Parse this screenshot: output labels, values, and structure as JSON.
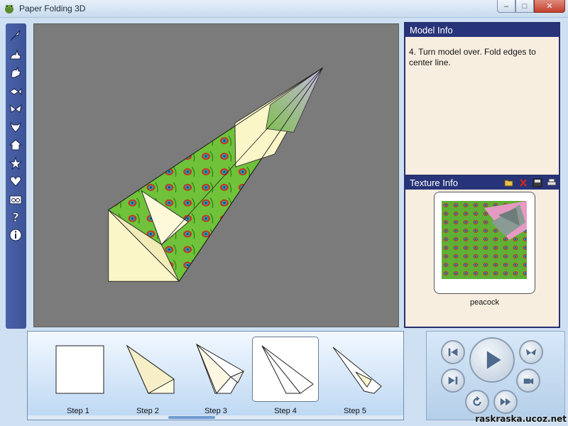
{
  "window": {
    "title": "Paper Folding 3D",
    "minimize": "–",
    "maximize": "□",
    "close": "✕"
  },
  "toolbar": {
    "items": [
      {
        "icon": "bird-icon"
      },
      {
        "icon": "rabbit-icon"
      },
      {
        "icon": "rooster-icon"
      },
      {
        "icon": "fish-icon"
      },
      {
        "icon": "butterfly-icon"
      },
      {
        "icon": "bull-head-icon"
      },
      {
        "icon": "house-icon"
      },
      {
        "icon": "star-icon"
      },
      {
        "icon": "heart-icon"
      },
      {
        "icon": "glasses-icon"
      },
      {
        "icon": "help-icon"
      },
      {
        "icon": "info-icon"
      }
    ]
  },
  "model_info": {
    "header": "Model Info",
    "text": "4. Turn model over. Fold edges to center line."
  },
  "texture_info": {
    "header": "Texture Info",
    "texture_name": "peacock",
    "header_icons": [
      "open-folder-icon",
      "delete-icon",
      "save-icon",
      "print-icon"
    ]
  },
  "steps": [
    {
      "label": "Step 1",
      "selected": false
    },
    {
      "label": "Step 2",
      "selected": false
    },
    {
      "label": "Step 3",
      "selected": false
    },
    {
      "label": "Step 4",
      "selected": true
    },
    {
      "label": "Step 5",
      "selected": false
    }
  ],
  "player": {
    "buttons": [
      "skip-to-start-icon",
      "play-icon",
      "butterfly-mode-icon",
      "skip-to-end-icon",
      "camera-icon",
      "rotate-icon",
      "fast-forward-icon"
    ]
  },
  "watermark": "raskraska.ucoz.net",
  "colors": {
    "panel_header": "#283479",
    "toolbar": "#4a62a8",
    "viewport_bg": "#7b7b7b",
    "peacock_green": "#6fc23a"
  }
}
